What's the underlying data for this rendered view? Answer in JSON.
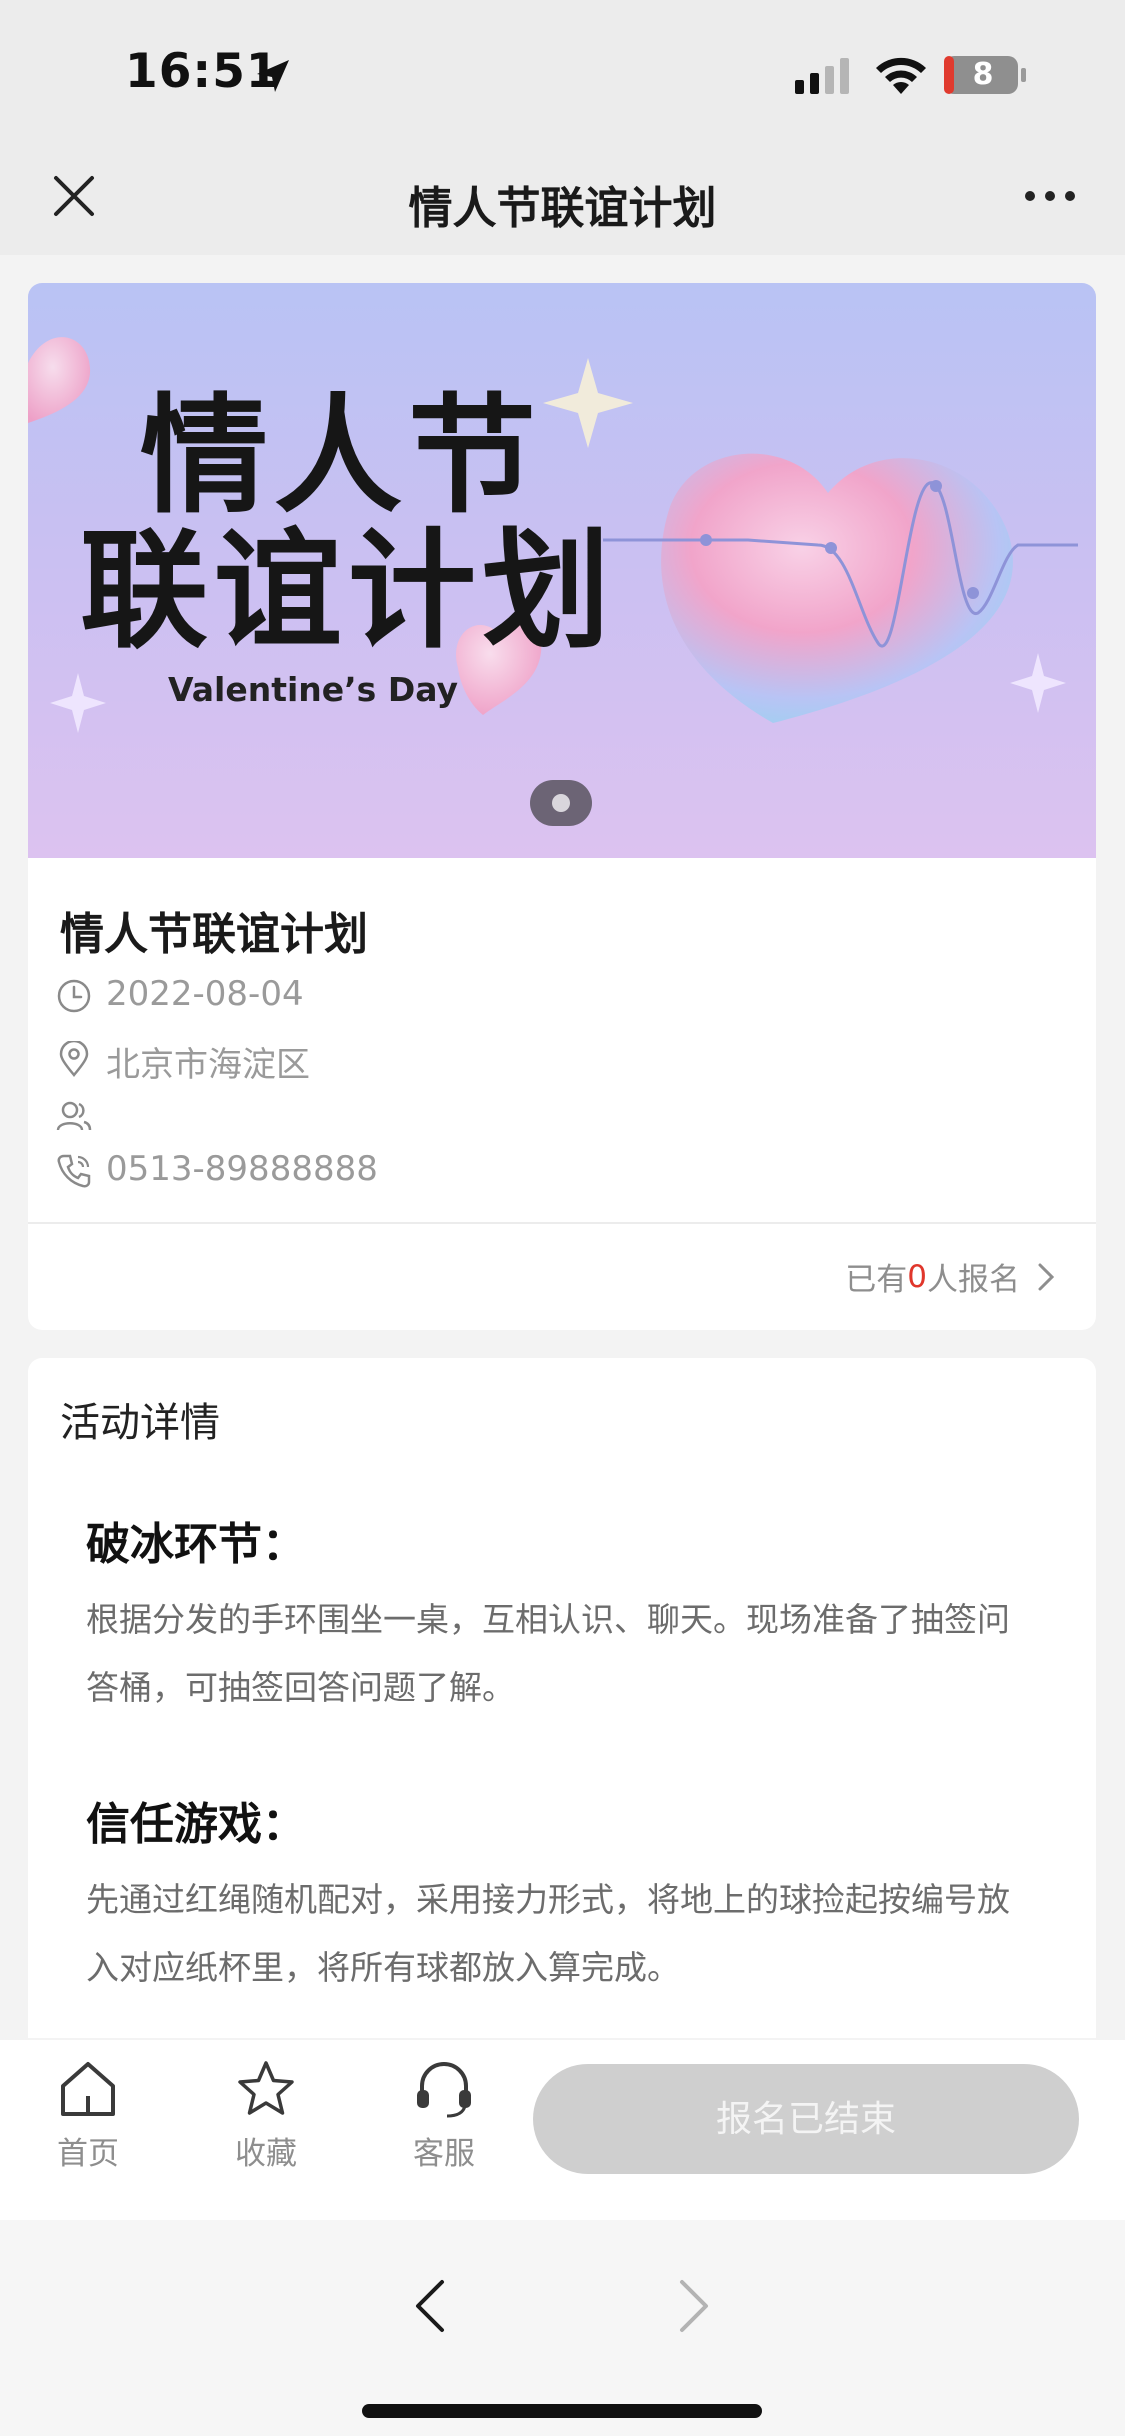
{
  "status_bar": {
    "time": "16:51",
    "battery": "8"
  },
  "nav": {
    "title": "情人节联谊计划",
    "close_icon": "close-icon",
    "more_icon": "more-icon"
  },
  "banner": {
    "title_line_1": "情人节",
    "title_line_2": "联谊计划",
    "subtitle": "Valentine’s Day",
    "slide_count": 1,
    "active_slide": 1
  },
  "event": {
    "title": "情人节联谊计划",
    "date": "2022-08-04",
    "location": "北京市海淀区",
    "participants": "",
    "phone": "0513-89888888",
    "signup_prefix": "已有",
    "signup_count": "0",
    "signup_suffix": "人报名"
  },
  "details": {
    "heading": "活动详情",
    "sections": [
      {
        "title": "破冰环节：",
        "body_line_1": "根据分发的手环围坐一桌，互相认识、聊天。现场准备了抽签问",
        "body_line_2": "答桶，可抽签回答问题了解。"
      },
      {
        "title": "信任游戏：",
        "body_line_1": "先通过红绳随机配对，采用接力形式，将地上的球捡起按编号放",
        "body_line_2": "入对应纸杯里，将所有球都放入算完成。"
      }
    ]
  },
  "action_bar": {
    "tabs": [
      {
        "label": "首页",
        "icon": "home-icon"
      },
      {
        "label": "收藏",
        "icon": "star-icon"
      },
      {
        "label": "客服",
        "icon": "headset-icon"
      }
    ],
    "register_label": "报名已结束",
    "register_enabled": false
  },
  "colors": {
    "accent_red": "#e0362b",
    "disabled_button": "#cfcfcf",
    "muted_text": "#9a9a9a"
  }
}
